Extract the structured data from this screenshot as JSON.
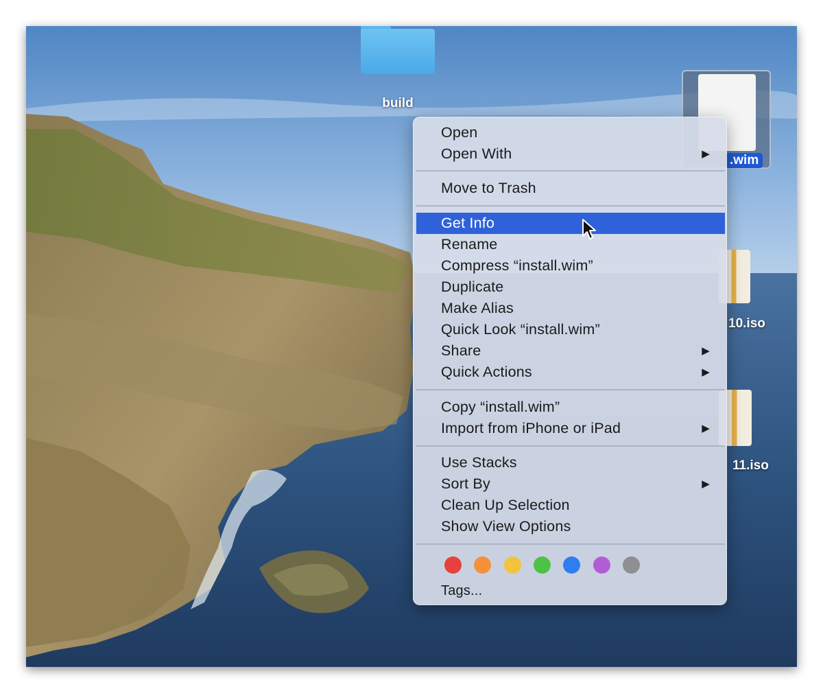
{
  "desktop": {
    "folder_label": "build",
    "selected_file_label": ".wim",
    "iso1_label": "10.iso",
    "iso2_label": "11.iso"
  },
  "context_menu": {
    "group1": [
      {
        "label": "Open",
        "submenu": false
      },
      {
        "label": "Open With",
        "submenu": true
      }
    ],
    "group2": [
      {
        "label": "Move to Trash",
        "submenu": false
      }
    ],
    "group3": [
      {
        "label": "Get Info",
        "submenu": false,
        "highlighted": true
      },
      {
        "label": "Rename",
        "submenu": false
      },
      {
        "label": "Compress “install.wim”",
        "submenu": false
      },
      {
        "label": "Duplicate",
        "submenu": false
      },
      {
        "label": "Make Alias",
        "submenu": false
      },
      {
        "label": "Quick Look “install.wim”",
        "submenu": false
      },
      {
        "label": "Share",
        "submenu": true
      },
      {
        "label": "Quick Actions",
        "submenu": true
      }
    ],
    "group4": [
      {
        "label": "Copy “install.wim”",
        "submenu": false
      },
      {
        "label": "Import from iPhone or iPad",
        "submenu": true
      }
    ],
    "group5": [
      {
        "label": "Use Stacks",
        "submenu": false
      },
      {
        "label": "Sort By",
        "submenu": true
      },
      {
        "label": "Clean Up Selection",
        "submenu": false
      },
      {
        "label": "Show View Options",
        "submenu": false
      }
    ],
    "submenu_arrow": "▶",
    "tags": {
      "colors": [
        "#e8403a",
        "#f2913a",
        "#f3c33c",
        "#4dc246",
        "#2f7ef0",
        "#b15ed6",
        "#8e8e93"
      ],
      "label": "Tags..."
    }
  },
  "icons": {
    "folder": "folder-icon",
    "file": "document-icon",
    "iso": "disk-image-icon",
    "cursor": "arrow-cursor-icon"
  }
}
